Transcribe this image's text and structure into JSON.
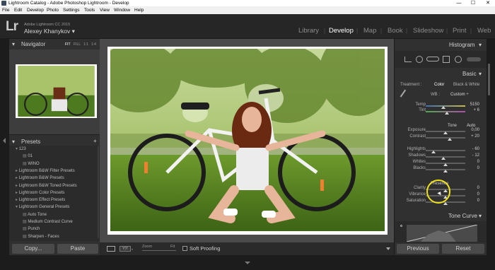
{
  "titlebar": {
    "title": "Lightroom Catalog - Adobe Photoshop Lightroom - Develop",
    "minimize": "—",
    "maximize": "☐",
    "close": "✕"
  },
  "menu": [
    "File",
    "Edit",
    "Develop",
    "Photo",
    "Settings",
    "Tools",
    "View",
    "Window",
    "Help"
  ],
  "identity": {
    "logo": "Lr",
    "version": "Adobe Lightroom CC 2015",
    "user": "Alexey Khanykov ▾"
  },
  "modules": [
    "Library",
    "Develop",
    "Map",
    "Book",
    "Slideshow",
    "Print",
    "Web"
  ],
  "active_module": "Develop",
  "navigator": {
    "title": "Navigator",
    "zoom_options": [
      "FIT",
      "FILL",
      "1:1",
      "1:4"
    ]
  },
  "presets": {
    "title": "Presets",
    "add": "+",
    "items": [
      {
        "label": "123",
        "type": "folder-open",
        "indent": 0
      },
      {
        "label": "01",
        "type": "preset",
        "indent": 1
      },
      {
        "label": "WINO",
        "type": "preset",
        "indent": 1
      },
      {
        "label": "Lightroom B&W Filter Presets",
        "type": "folder",
        "indent": 0
      },
      {
        "label": "Lightroom B&W Presets",
        "type": "folder",
        "indent": 0
      },
      {
        "label": "Lightroom B&W Toned Presets",
        "type": "folder",
        "indent": 0
      },
      {
        "label": "Lightroom Color Presets",
        "type": "folder",
        "indent": 0
      },
      {
        "label": "Lightroom Effect Presets",
        "type": "folder",
        "indent": 0
      },
      {
        "label": "Lightroom General Presets",
        "type": "folder-open",
        "indent": 0
      },
      {
        "label": "Auto Tone",
        "type": "preset",
        "indent": 1
      },
      {
        "label": "Medium Contrast Curve",
        "type": "preset",
        "indent": 1
      },
      {
        "label": "Punch",
        "type": "preset",
        "indent": 1
      },
      {
        "label": "Sharpen - Faces",
        "type": "preset",
        "indent": 1
      }
    ]
  },
  "left_buttons": {
    "copy": "Copy...",
    "paste": "Paste"
  },
  "histogram": {
    "title": "Histogram"
  },
  "basic": {
    "title": "Basic",
    "treatment_label": "Treatment :",
    "treatment_color": "Color",
    "treatment_bw": "Black & White",
    "wb_label": "WB :",
    "wb_value": "Custom ÷",
    "temp": {
      "label": "Temp",
      "value": "5150",
      "level": 0.45
    },
    "tint": {
      "label": "Tint",
      "value": "+ 6",
      "level": 0.53
    },
    "tone_label": "Tone",
    "auto": "Auto",
    "exposure": {
      "label": "Exposure",
      "value": "0,00",
      "level": 0.5
    },
    "contrast": {
      "label": "Contrast",
      "value": "+ 20",
      "level": 0.6
    },
    "highlights": {
      "label": "Highlights",
      "value": "- 60",
      "level": 0.2
    },
    "shadows": {
      "label": "Shadows",
      "value": "- 12",
      "level": 0.44
    },
    "whites": {
      "label": "Whites",
      "value": "0",
      "level": 0.5
    },
    "blacks": {
      "label": "Blacks",
      "value": "0",
      "level": 0.5
    },
    "presence_label": "Presence",
    "clarity": {
      "label": "Clarity",
      "value": "0",
      "level": 0.5
    },
    "vibrance": {
      "label": "Vibrance",
      "value": "0",
      "level": 0.5
    },
    "saturation": {
      "label": "Saturation",
      "value": "0",
      "level": 0.5
    }
  },
  "tone_curve": {
    "title": "Tone Curve"
  },
  "right_buttons": {
    "previous": "Previous",
    "reset": "Reset"
  },
  "toolbar": {
    "zoom_label": "Zoom",
    "zoom_value": "Fit",
    "soft_proofing": "Soft Proofing"
  },
  "colors": {
    "accent": "#ffffff",
    "panel": "#303030",
    "highlight_circle": "#f0e21a"
  }
}
